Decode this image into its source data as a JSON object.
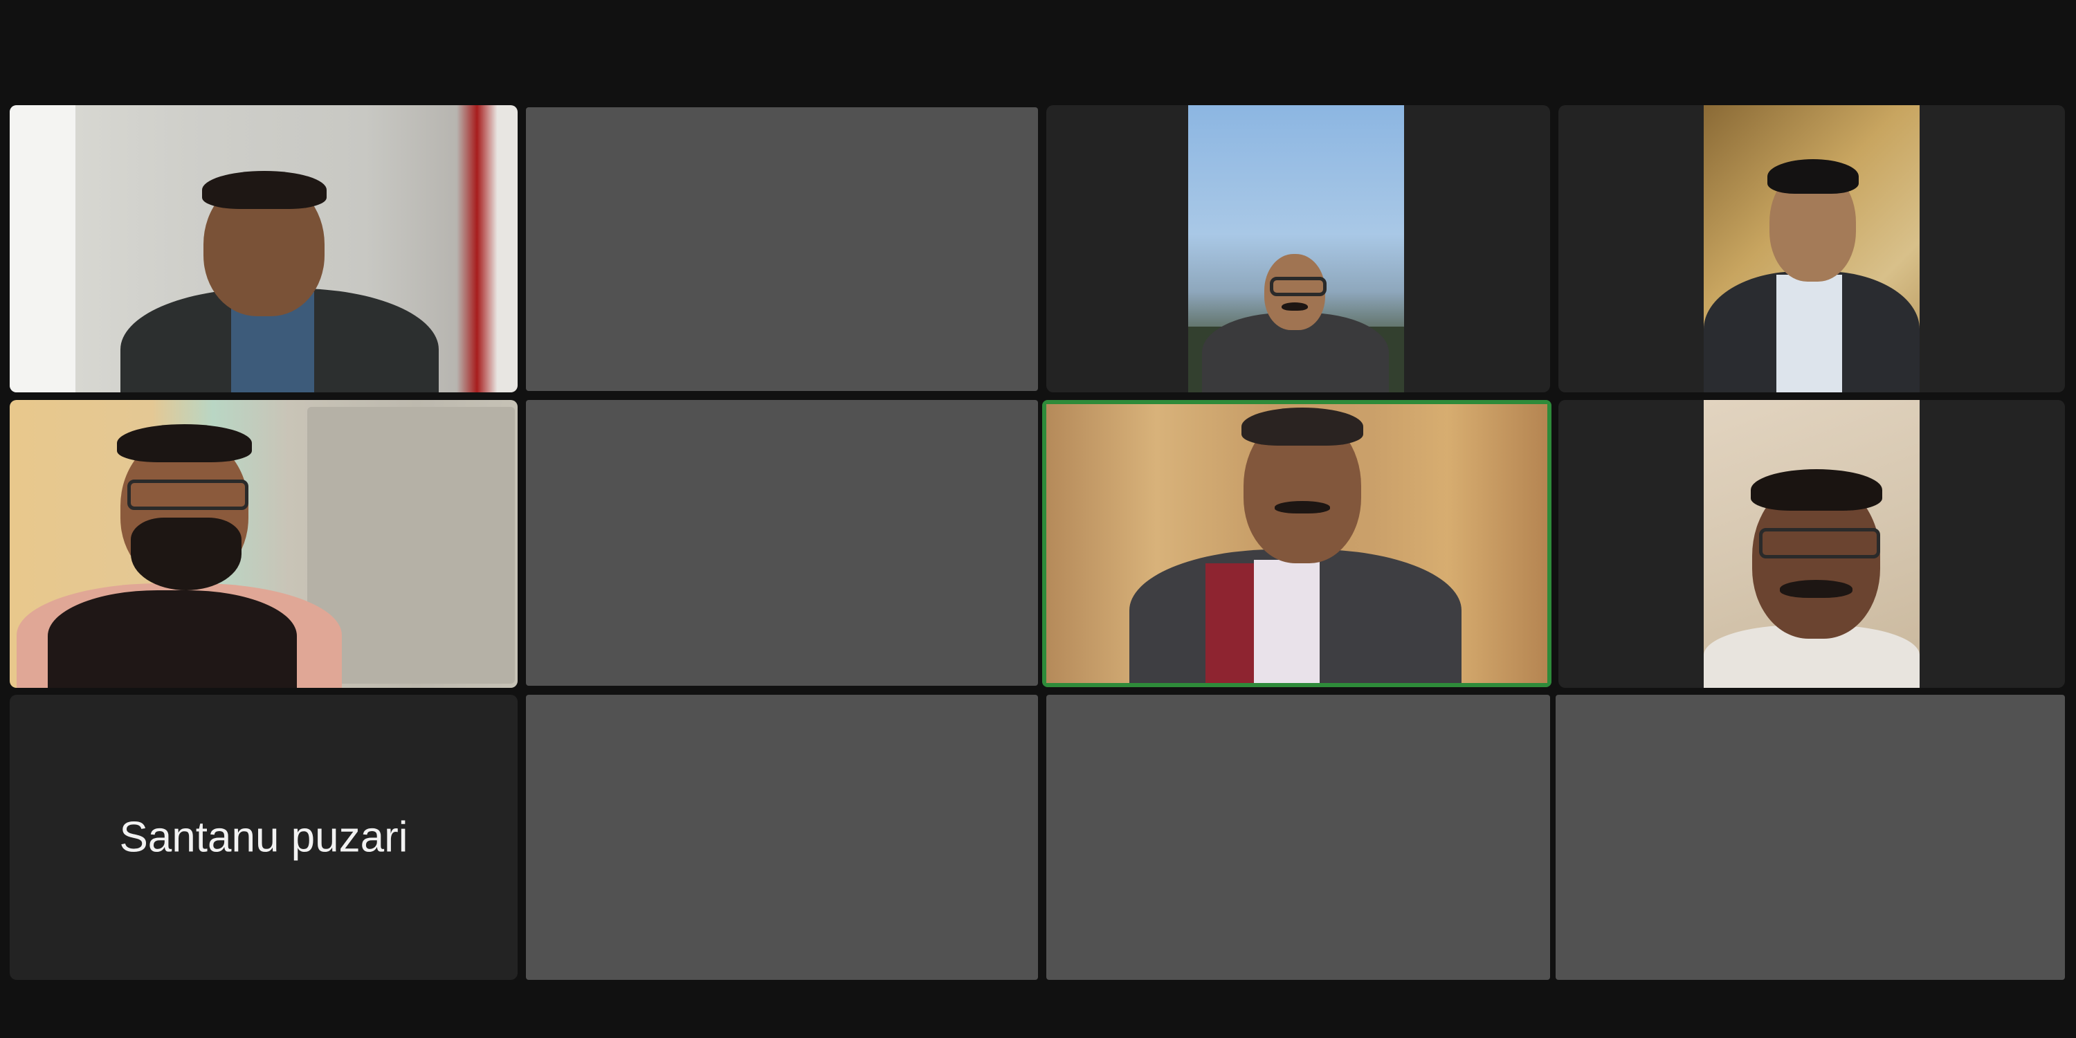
{
  "meeting": {
    "tiles": [
      {
        "id": "t1",
        "type": "video"
      },
      {
        "id": "t2",
        "type": "empty"
      },
      {
        "id": "t3",
        "type": "video"
      },
      {
        "id": "t4",
        "type": "video"
      },
      {
        "id": "t5",
        "type": "video"
      },
      {
        "id": "t6",
        "type": "empty"
      },
      {
        "id": "t7",
        "type": "video",
        "active_speaker": true
      },
      {
        "id": "t8",
        "type": "video"
      },
      {
        "id": "t9",
        "type": "name",
        "display_name": "Santanu puzari"
      },
      {
        "id": "t10",
        "type": "empty"
      },
      {
        "id": "t11",
        "type": "empty"
      },
      {
        "id": "t12",
        "type": "empty"
      }
    ],
    "colors": {
      "background": "#111111",
      "tile": "#232323",
      "empty_tile": "#525252",
      "active_speaker_border": "#2e8b3a"
    }
  }
}
